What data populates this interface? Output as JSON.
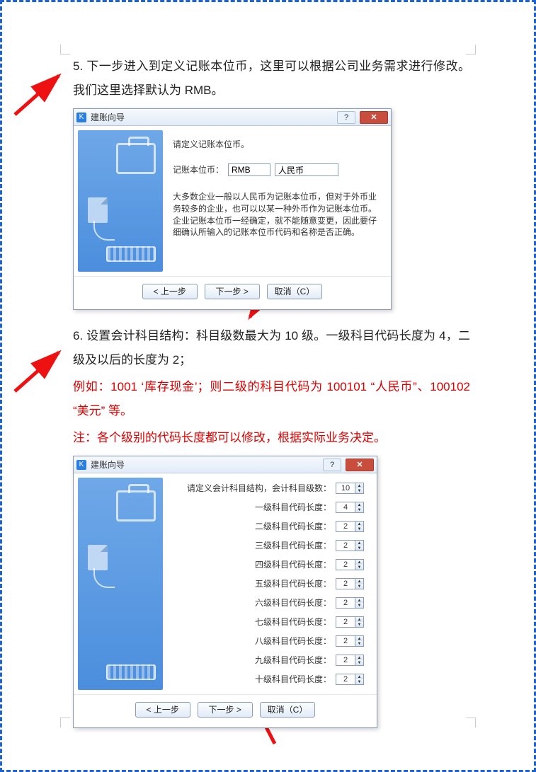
{
  "para5": "5. 下一步进入到定义记账本位币，这里可以根据公司业务需求进行修改。我们这里选择默认为 RMB。",
  "wizard1": {
    "title": "建账向导",
    "prompt": "请定义记账本位币。",
    "currencyLabel": "记账本位币：",
    "codeValue": "RMB",
    "nameValue": "人民币",
    "note": "大多数企业一般以人民币为记账本位币，但对于外币业务较多的企业，也可以以某一种外币作为记账本位币。企业记账本位币一经确定，就不能随意变更，因此要仔细确认所输入的记账本位币代码和名称是否正确。",
    "btnPrev": "< 上一步",
    "btnNext": "下一步 >",
    "btnCancel": "取消（C）"
  },
  "para6": "6.  设置会计科目结构：科目级数最大为 10 级。一级科目代码长度为 4，二级及以后的长度为 2；",
  "example": "例如：1001 ‘库存现金’；则二级的科目代码为 100101 “人民币”、100102 “美元” 等。",
  "noteRed": "注：各个级别的代码长度都可以修改，根据实际业务决定。",
  "wizard2": {
    "title": "建账向导",
    "prompt": "请定义会计科目结构，会计科目级数：",
    "levelCount": "10",
    "rows": [
      {
        "label": "一级科目代码长度：",
        "value": "4"
      },
      {
        "label": "二级科目代码长度：",
        "value": "2"
      },
      {
        "label": "三级科目代码长度：",
        "value": "2"
      },
      {
        "label": "四级科目代码长度：",
        "value": "2"
      },
      {
        "label": "五级科目代码长度：",
        "value": "2"
      },
      {
        "label": "六级科目代码长度：",
        "value": "2"
      },
      {
        "label": "七级科目代码长度：",
        "value": "2"
      },
      {
        "label": "八级科目代码长度：",
        "value": "2"
      },
      {
        "label": "九级科目代码长度：",
        "value": "2"
      },
      {
        "label": "十级科目代码长度：",
        "value": "2"
      }
    ],
    "btnPrev": "< 上一步",
    "btnNext": "下一步 >",
    "btnCancel": "取消（C）"
  }
}
